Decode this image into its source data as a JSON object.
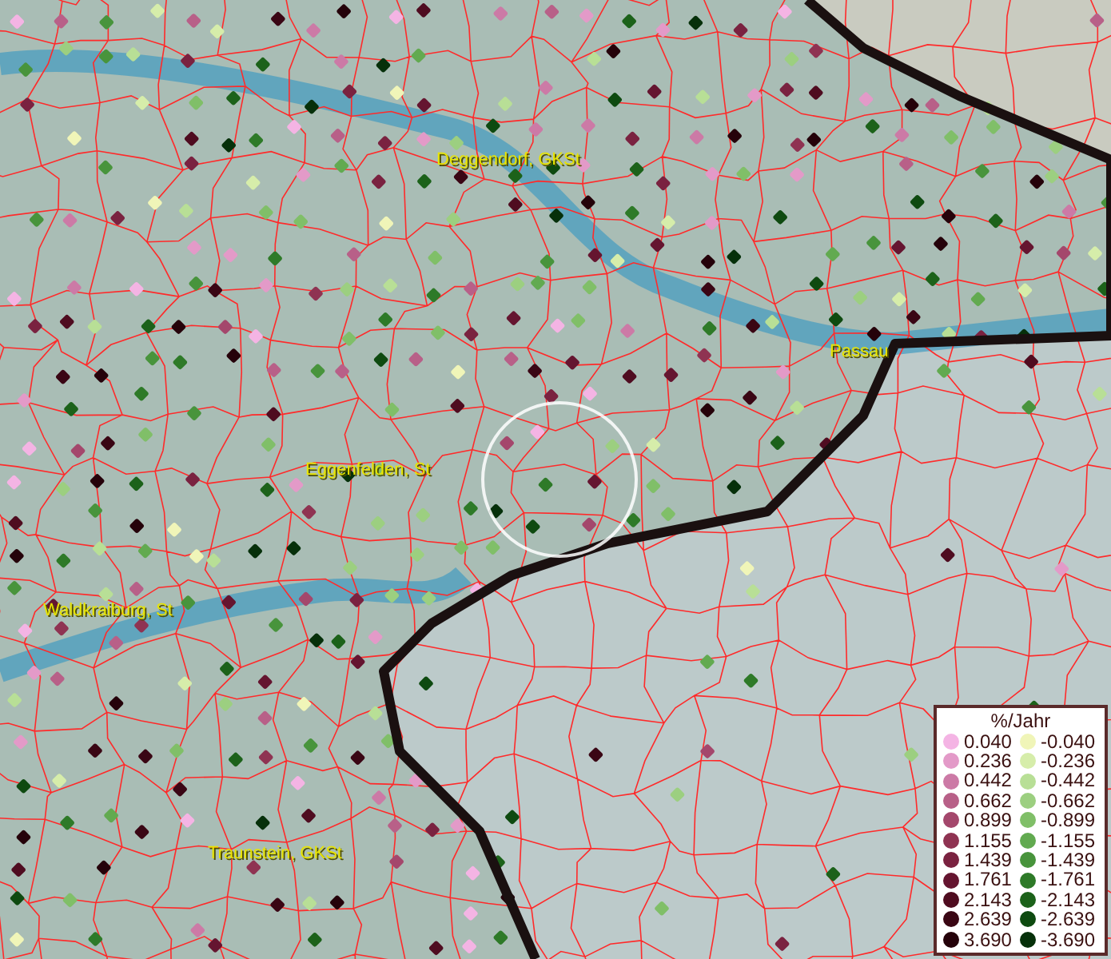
{
  "places": [
    {
      "name": "Deggendorf, GKSt"
    },
    {
      "name": "Passau"
    },
    {
      "name": "Eggenfelden, St"
    },
    {
      "name": "Waldkraiburg, St"
    },
    {
      "name": "Traunstein, GKSt"
    }
  ],
  "legend": {
    "title": "%/Jahr",
    "positive": [
      {
        "label": "0.040",
        "color": "#f4b4e4"
      },
      {
        "label": "0.236",
        "color": "#e39ac8"
      },
      {
        "label": "0.442",
        "color": "#cc7aa6"
      },
      {
        "label": "0.662",
        "color": "#b86088"
      },
      {
        "label": "0.899",
        "color": "#a4476c"
      },
      {
        "label": "1.155",
        "color": "#8f3352"
      },
      {
        "label": "1.439",
        "color": "#7a2240"
      },
      {
        "label": "1.761",
        "color": "#651530"
      },
      {
        "label": "2.143",
        "color": "#4f0c20"
      },
      {
        "label": "2.639",
        "color": "#3a0614"
      },
      {
        "label": "3.690",
        "color": "#25020a"
      }
    ],
    "negative": [
      {
        "label": "-0.040",
        "color": "#f0f5b8"
      },
      {
        "label": "-0.236",
        "color": "#d6edaa"
      },
      {
        "label": "-0.442",
        "color": "#b8df96"
      },
      {
        "label": "-0.662",
        "color": "#9ccf80"
      },
      {
        "label": "-0.899",
        "color": "#80bf68"
      },
      {
        "label": "-1.155",
        "color": "#62aa50"
      },
      {
        "label": "-1.439",
        "color": "#48943c"
      },
      {
        "label": "-1.761",
        "color": "#2e7a28"
      },
      {
        "label": "-2.143",
        "color": "#1c621a"
      },
      {
        "label": "-2.639",
        "color": "#0e4a10"
      },
      {
        "label": "-3.690",
        "color": "#06300a"
      }
    ]
  }
}
